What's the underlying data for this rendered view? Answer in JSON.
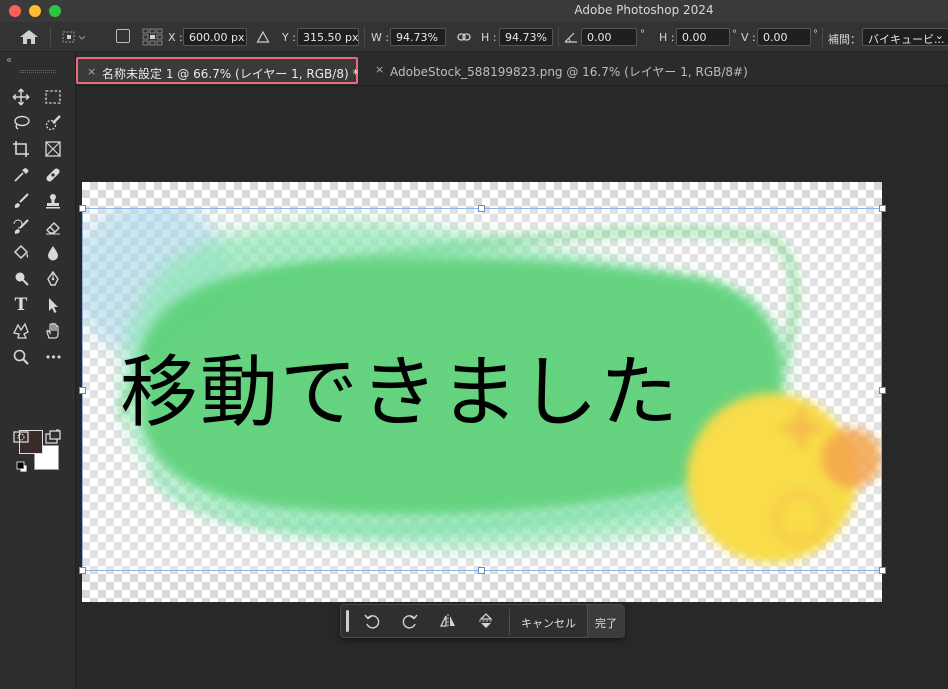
{
  "window": {
    "title": "Adobe Photoshop 2024"
  },
  "options_bar": {
    "x_label": "X :",
    "x_value": "600.00 px",
    "y_label": "Y :",
    "y_value": "315.50 px",
    "w_label": "W :",
    "w_value": "94.73%",
    "h_label": "H :",
    "h_value": "94.73%",
    "rotate_value": "0.00",
    "skew_h_label": "H :",
    "skew_h_value": "0.00",
    "skew_v_label": "V :",
    "skew_v_value": "0.00",
    "degree_symbol": "°",
    "interp_label": "補間：",
    "interp_value": "バイキュービ...",
    "dropdown_chevron": "⌄"
  },
  "tabs": [
    {
      "close": "×",
      "label": "名称未設定 1 @ 66.7% (レイヤー 1, RGB/8) *",
      "active": true
    },
    {
      "close": "×",
      "label": "AdobeStock_588199823.png @ 16.7% (レイヤー 1, RGB/8#)",
      "active": false
    }
  ],
  "toolbar": {
    "collapse": "«",
    "tools": [
      "move-icon",
      "marquee-icon",
      "lasso-icon",
      "quick-select-icon",
      "crop-icon",
      "frame-icon",
      "eyedropper-icon",
      "healing-icon",
      "brush-icon",
      "stamp-icon",
      "history-brush-icon",
      "eraser-icon",
      "paint-bucket-icon",
      "blur-icon",
      "dodge-icon",
      "pen-icon",
      "type-icon",
      "path-select-icon",
      "shape-icon",
      "hand-icon",
      "zoom-icon",
      "more-icon"
    ],
    "type_glyph": "T",
    "more_glyph": "•••",
    "swap_glyph": "↺",
    "foreground_color": "#3b2a2a",
    "background_color": "#ffffff"
  },
  "canvas": {
    "text": "移動できました",
    "colors": {
      "green": "#5fd17a",
      "light_green": "#8fe7b5",
      "yellow": "#f8dc4a",
      "orange": "#f4a44e",
      "blue": "#9fd3e8"
    }
  },
  "transform_bar": {
    "cancel_label": "キャンセル",
    "done_label": "完了"
  },
  "accent": {
    "active_tab_outline": "#e86b7a",
    "handle_blue": "#5a8fd6"
  }
}
